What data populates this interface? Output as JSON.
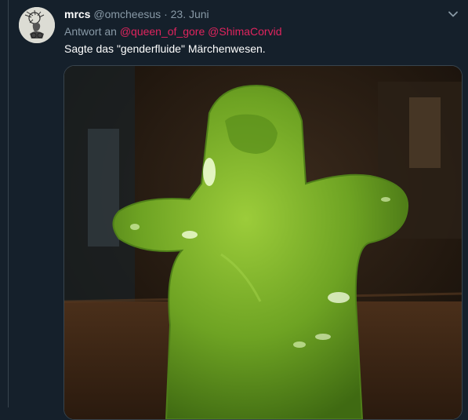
{
  "tweet": {
    "display_name": "mrcs",
    "handle": "@omcheesus",
    "separator": "·",
    "date": "23. Juni",
    "reply_prefix": "Antwort an",
    "mentions": [
      "@queen_of_gore",
      "@ShimaCorvid"
    ],
    "text": "Sagte das \"genderfluide\" Märchenwesen.",
    "media": {
      "type": "gif-thumbnail",
      "subject": "green-jelly-figure"
    }
  },
  "icons": {
    "menu": "chevron-down-icon",
    "avatar": "avatar"
  },
  "colors": {
    "background": "#15202b",
    "secondary_text": "#8899a6",
    "mention": "#e0245e",
    "border": "#38444d",
    "jelly": "#7fb52a"
  }
}
